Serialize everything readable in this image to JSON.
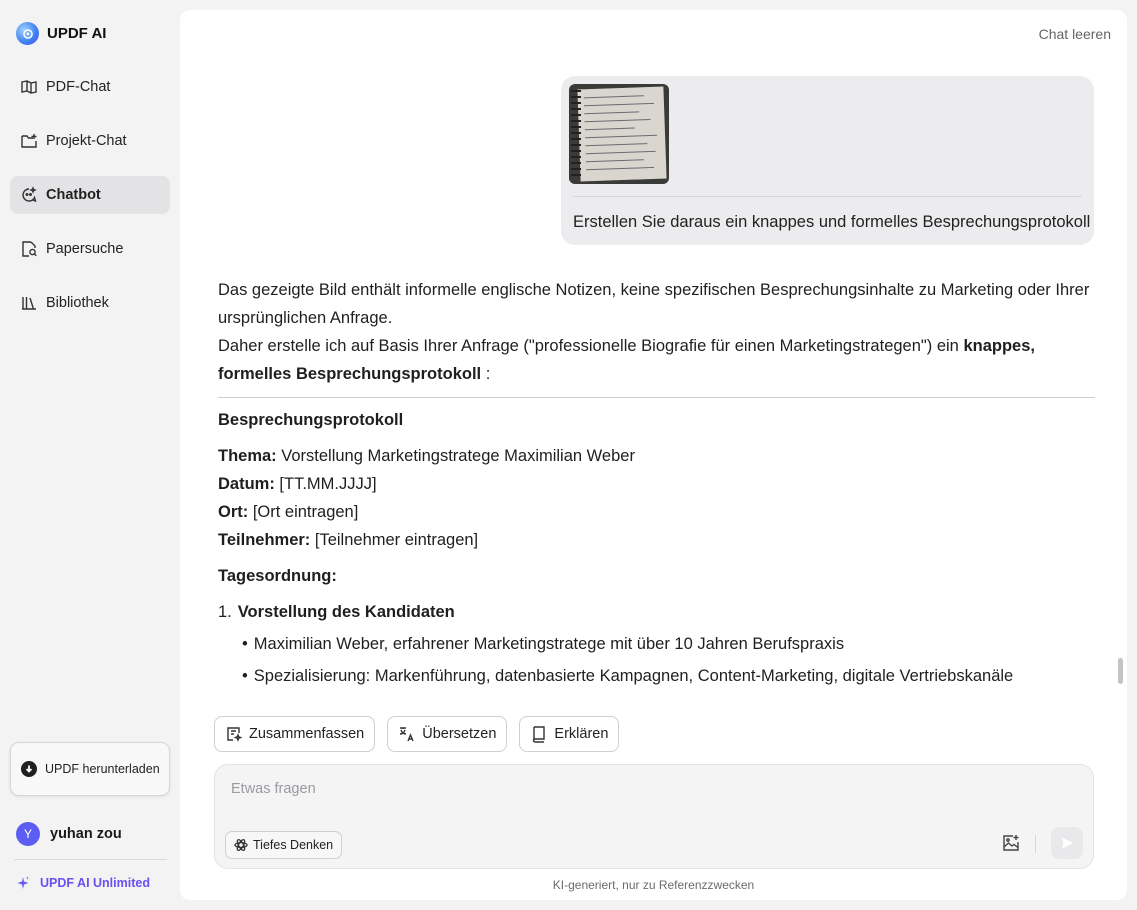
{
  "sidebar": {
    "brand": "UPDF AI",
    "items": [
      {
        "label": "PDF-Chat",
        "icon": "open-book-icon"
      },
      {
        "label": "Projekt-Chat",
        "icon": "folder-plus-icon"
      },
      {
        "label": "Chatbot",
        "icon": "chatbot-icon",
        "active": true
      },
      {
        "label": "Papersuche",
        "icon": "search-document-icon"
      },
      {
        "label": "Bibliothek",
        "icon": "library-icon"
      }
    ],
    "download_label": "UPDF herunterladen",
    "user": {
      "initial": "Y",
      "name": "yuhan zou"
    },
    "unlimited_label": "UPDF AI Unlimited"
  },
  "header": {
    "clear_chat": "Chat leeren"
  },
  "user_message": {
    "text": "Erstellen Sie daraus ein knappes und formelles Besprechungsprotokoll"
  },
  "answer": {
    "intro1": "Das gezeigte Bild enthält informelle englische Notizen, keine spezifischen Besprechungsinhalte zu Marketing oder Ihrer ursprünglichen Anfrage.",
    "intro2_pre": "Daher erstelle ich auf Basis Ihrer Anfrage (\"professionelle Biografie für einen Marketingstrategen\") ein ",
    "intro2_bold": "knappes, formelles Besprechungsprotokoll",
    "intro2_post": " :",
    "heading": "Besprechungsprotokoll",
    "fields": [
      {
        "key": "Thema:",
        "value": " Vorstellung Marketingstratege Maximilian Weber"
      },
      {
        "key": "Datum:",
        "value": " [TT.MM.JJJJ]"
      },
      {
        "key": "Ort:",
        "value": " [Ort eintragen]"
      },
      {
        "key": "Teilnehmer:",
        "value": " [Teilnehmer eintragen]"
      }
    ],
    "agenda_label": "Tagesordnung:",
    "agenda_item_num": "1.",
    "agenda_item_title": "Vorstellung des Kandidaten",
    "bullets": [
      "Maximilian Weber, erfahrener Marketingstratege mit über 10 Jahren Berufspraxis",
      "Spezialisierung: Markenführung, datenbasierte Kampagnen, Content-Marketing, digitale Vertriebskanäle"
    ]
  },
  "actions": [
    {
      "label": "Zusammenfassen",
      "icon": "summarize-icon"
    },
    {
      "label": "Übersetzen",
      "icon": "translate-icon"
    },
    {
      "label": "Erklären",
      "icon": "book-icon"
    }
  ],
  "composer": {
    "placeholder": "Etwas fragen",
    "deep_thinking": "Tiefes Denken"
  },
  "disclaimer": "KI-generiert, nur zu Referenzzwecken",
  "colors": {
    "accent": "#6b4ff0",
    "active_nav": "#e3e3e5",
    "bubble": "#ececee"
  }
}
